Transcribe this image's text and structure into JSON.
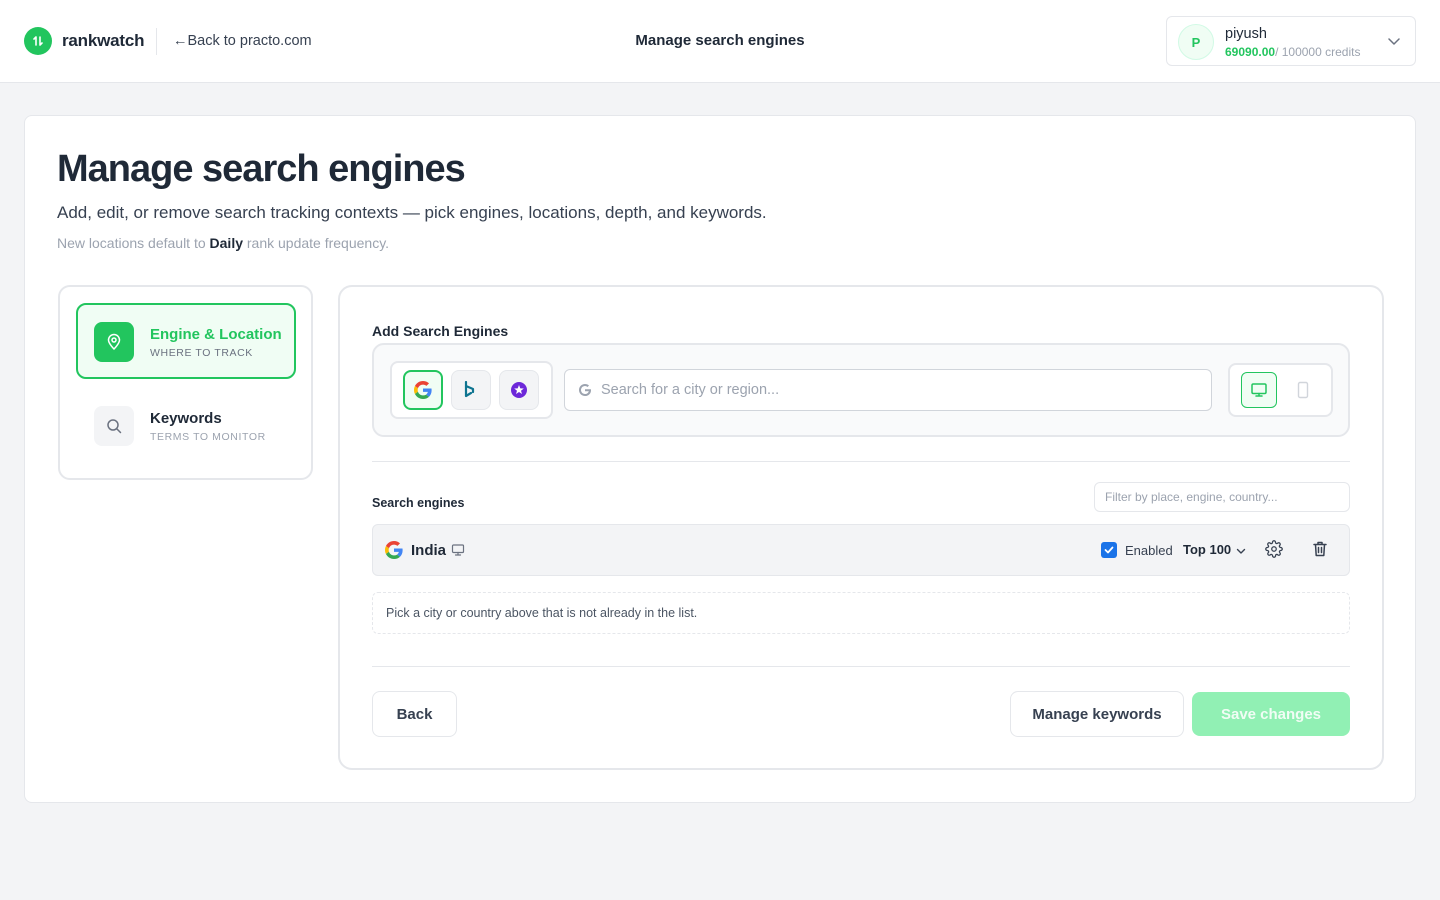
{
  "header": {
    "brand": "rankwatch",
    "back_link": "←Back to practo.com",
    "title": "Manage search engines",
    "user": {
      "initial": "P",
      "name": "piyush",
      "credits_used": "69090.00",
      "credits_total": "/ 100000 credits"
    }
  },
  "page": {
    "title": "Manage search engines",
    "subtitle": "Add, edit, or remove search tracking contexts — pick engines, locations, depth, and keywords.",
    "note_prefix": "New locations default to ",
    "note_bold": "Daily",
    "note_suffix": " rank update frequency."
  },
  "steps": [
    {
      "title": "Engine & Location",
      "subtitle": "WHERE TO TRACK",
      "icon": "map-pin-icon",
      "active": true
    },
    {
      "title": "Keywords",
      "subtitle": "TERMS TO MONITOR",
      "icon": "search-icon",
      "active": false
    }
  ],
  "add_section": {
    "label": "Add Search Engines",
    "engines": [
      {
        "name": "google-icon",
        "selected": true
      },
      {
        "name": "bing-icon",
        "selected": false
      },
      {
        "name": "yahoo-icon",
        "selected": false
      }
    ],
    "search_placeholder": "Search for a city or region...",
    "devices": [
      {
        "name": "desktop-icon",
        "selected": true
      },
      {
        "name": "mobile-icon",
        "selected": false
      }
    ]
  },
  "list_section": {
    "label": "Search engines",
    "filter_placeholder": "Filter by place, engine, country...",
    "rows": [
      {
        "engine": "google-icon",
        "location": "India",
        "device": "desktop-icon",
        "enabled": true,
        "enabled_label": "Enabled",
        "depth": "Top 100"
      }
    ],
    "hint": "Pick a city or country above that is not already in the list."
  },
  "footer": {
    "back": "Back",
    "manage_keywords": "Manage keywords",
    "save": "Save changes"
  },
  "colors": {
    "accent": "#22c55e",
    "accent_light": "#f0fdf4",
    "save_disabled": "#86efac",
    "checkbox": "#1a73e8"
  }
}
